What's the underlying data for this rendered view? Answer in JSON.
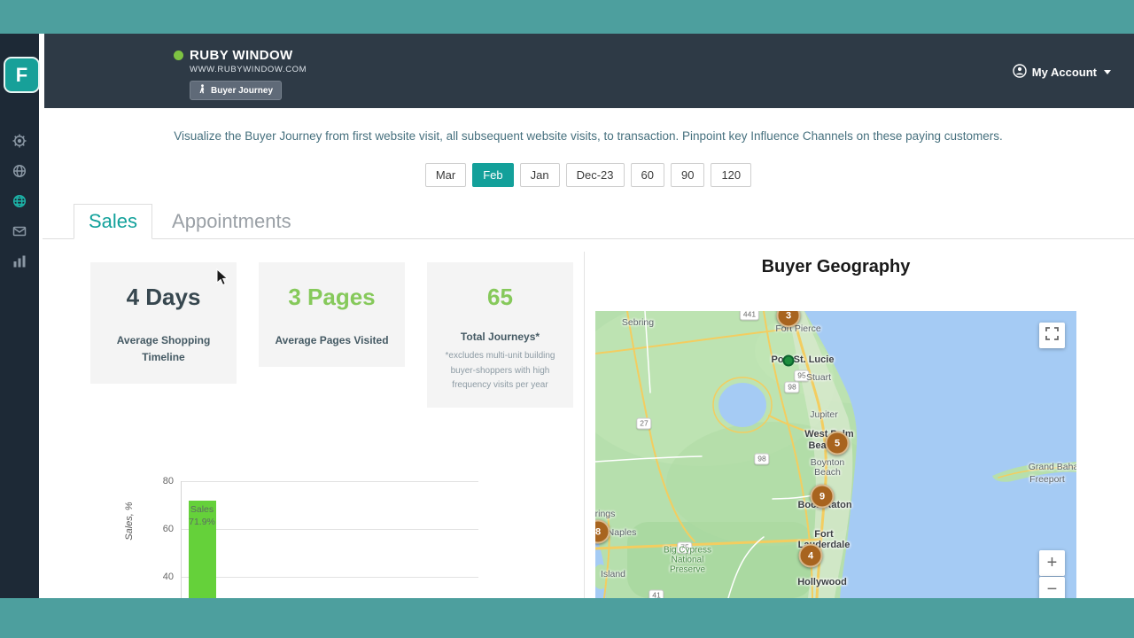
{
  "header": {
    "brand": "RUBY WINDOW",
    "website": "WWW.RUBYWINDOW.COM",
    "badge": "Buyer Journey",
    "account": "My Account"
  },
  "sidebar": {
    "logo_letter": "F"
  },
  "intro": {
    "text": "Visualize the Buyer Journey from first website visit, all subsequent website visits, to transaction. Pinpoint key Influence Channels on these paying customers."
  },
  "filters": {
    "items": [
      {
        "label": "Mar",
        "active": false
      },
      {
        "label": "Feb",
        "active": true
      },
      {
        "label": "Jan",
        "active": false
      },
      {
        "label": "Dec-23",
        "active": false
      },
      {
        "label": "60",
        "active": false
      },
      {
        "label": "90",
        "active": false
      },
      {
        "label": "120",
        "active": false
      }
    ]
  },
  "tabs": {
    "sales": "Sales",
    "appointments": "Appointments"
  },
  "stats": [
    {
      "value": "4 Days",
      "label_line1": "Average Shopping",
      "label_line2": "Timeline"
    },
    {
      "value": "3 Pages",
      "label_line1": "Average Pages Visited"
    },
    {
      "value": "65",
      "label_line1": "Total Journeys*",
      "note_line1": "*excludes multi-unit building",
      "note_line2": "buyer-shoppers with high",
      "note_line3": "frequency visits per year"
    }
  ],
  "chart_data": {
    "type": "bar",
    "categories": [
      "Sales"
    ],
    "values": [
      71.9
    ],
    "series_label": "Sales",
    "value_label": "71.9%",
    "ylabel": "Sales, %",
    "yticks": [
      80,
      60,
      40
    ],
    "ytick_labels": [
      "80",
      "60",
      "40"
    ],
    "ylim_visible": [
      40,
      80
    ]
  },
  "map": {
    "title": "Buyer Geography",
    "markers": [
      {
        "count": "3"
      },
      {
        "count": "5"
      },
      {
        "count": "9"
      },
      {
        "count": "8"
      },
      {
        "count": "4"
      }
    ],
    "labels": {
      "sebring": "Sebring",
      "fort_pierce": "Fort Pierce",
      "port_st_lucie": "Port St. Lucie",
      "stuart": "Stuart",
      "jupiter": "Jupiter",
      "west_palm_1": "West Palm",
      "west_palm_2": "Beach",
      "boynton_1": "Boynton",
      "boynton_2": "Beach",
      "boca_raton": "Boca Raton",
      "fort_lauderdale_1": "Fort",
      "fort_lauderdale_2": "Lauderdale",
      "hollywood": "Hollywood",
      "naples": "Naples",
      "big_cypress_1": "Big Cypress",
      "big_cypress_2": "National",
      "big_cypress_3": "Preserve",
      "springs_partial": "rings",
      "island": "Island",
      "grand_bahama": "Grand Baha",
      "freeport": "Freeport"
    },
    "shields": {
      "s441": "441",
      "s95": "95",
      "s98a": "98",
      "s98b": "98",
      "s27": "27",
      "s75": "75",
      "s41": "41"
    },
    "zoom_in": "+",
    "zoom_out": "−"
  }
}
